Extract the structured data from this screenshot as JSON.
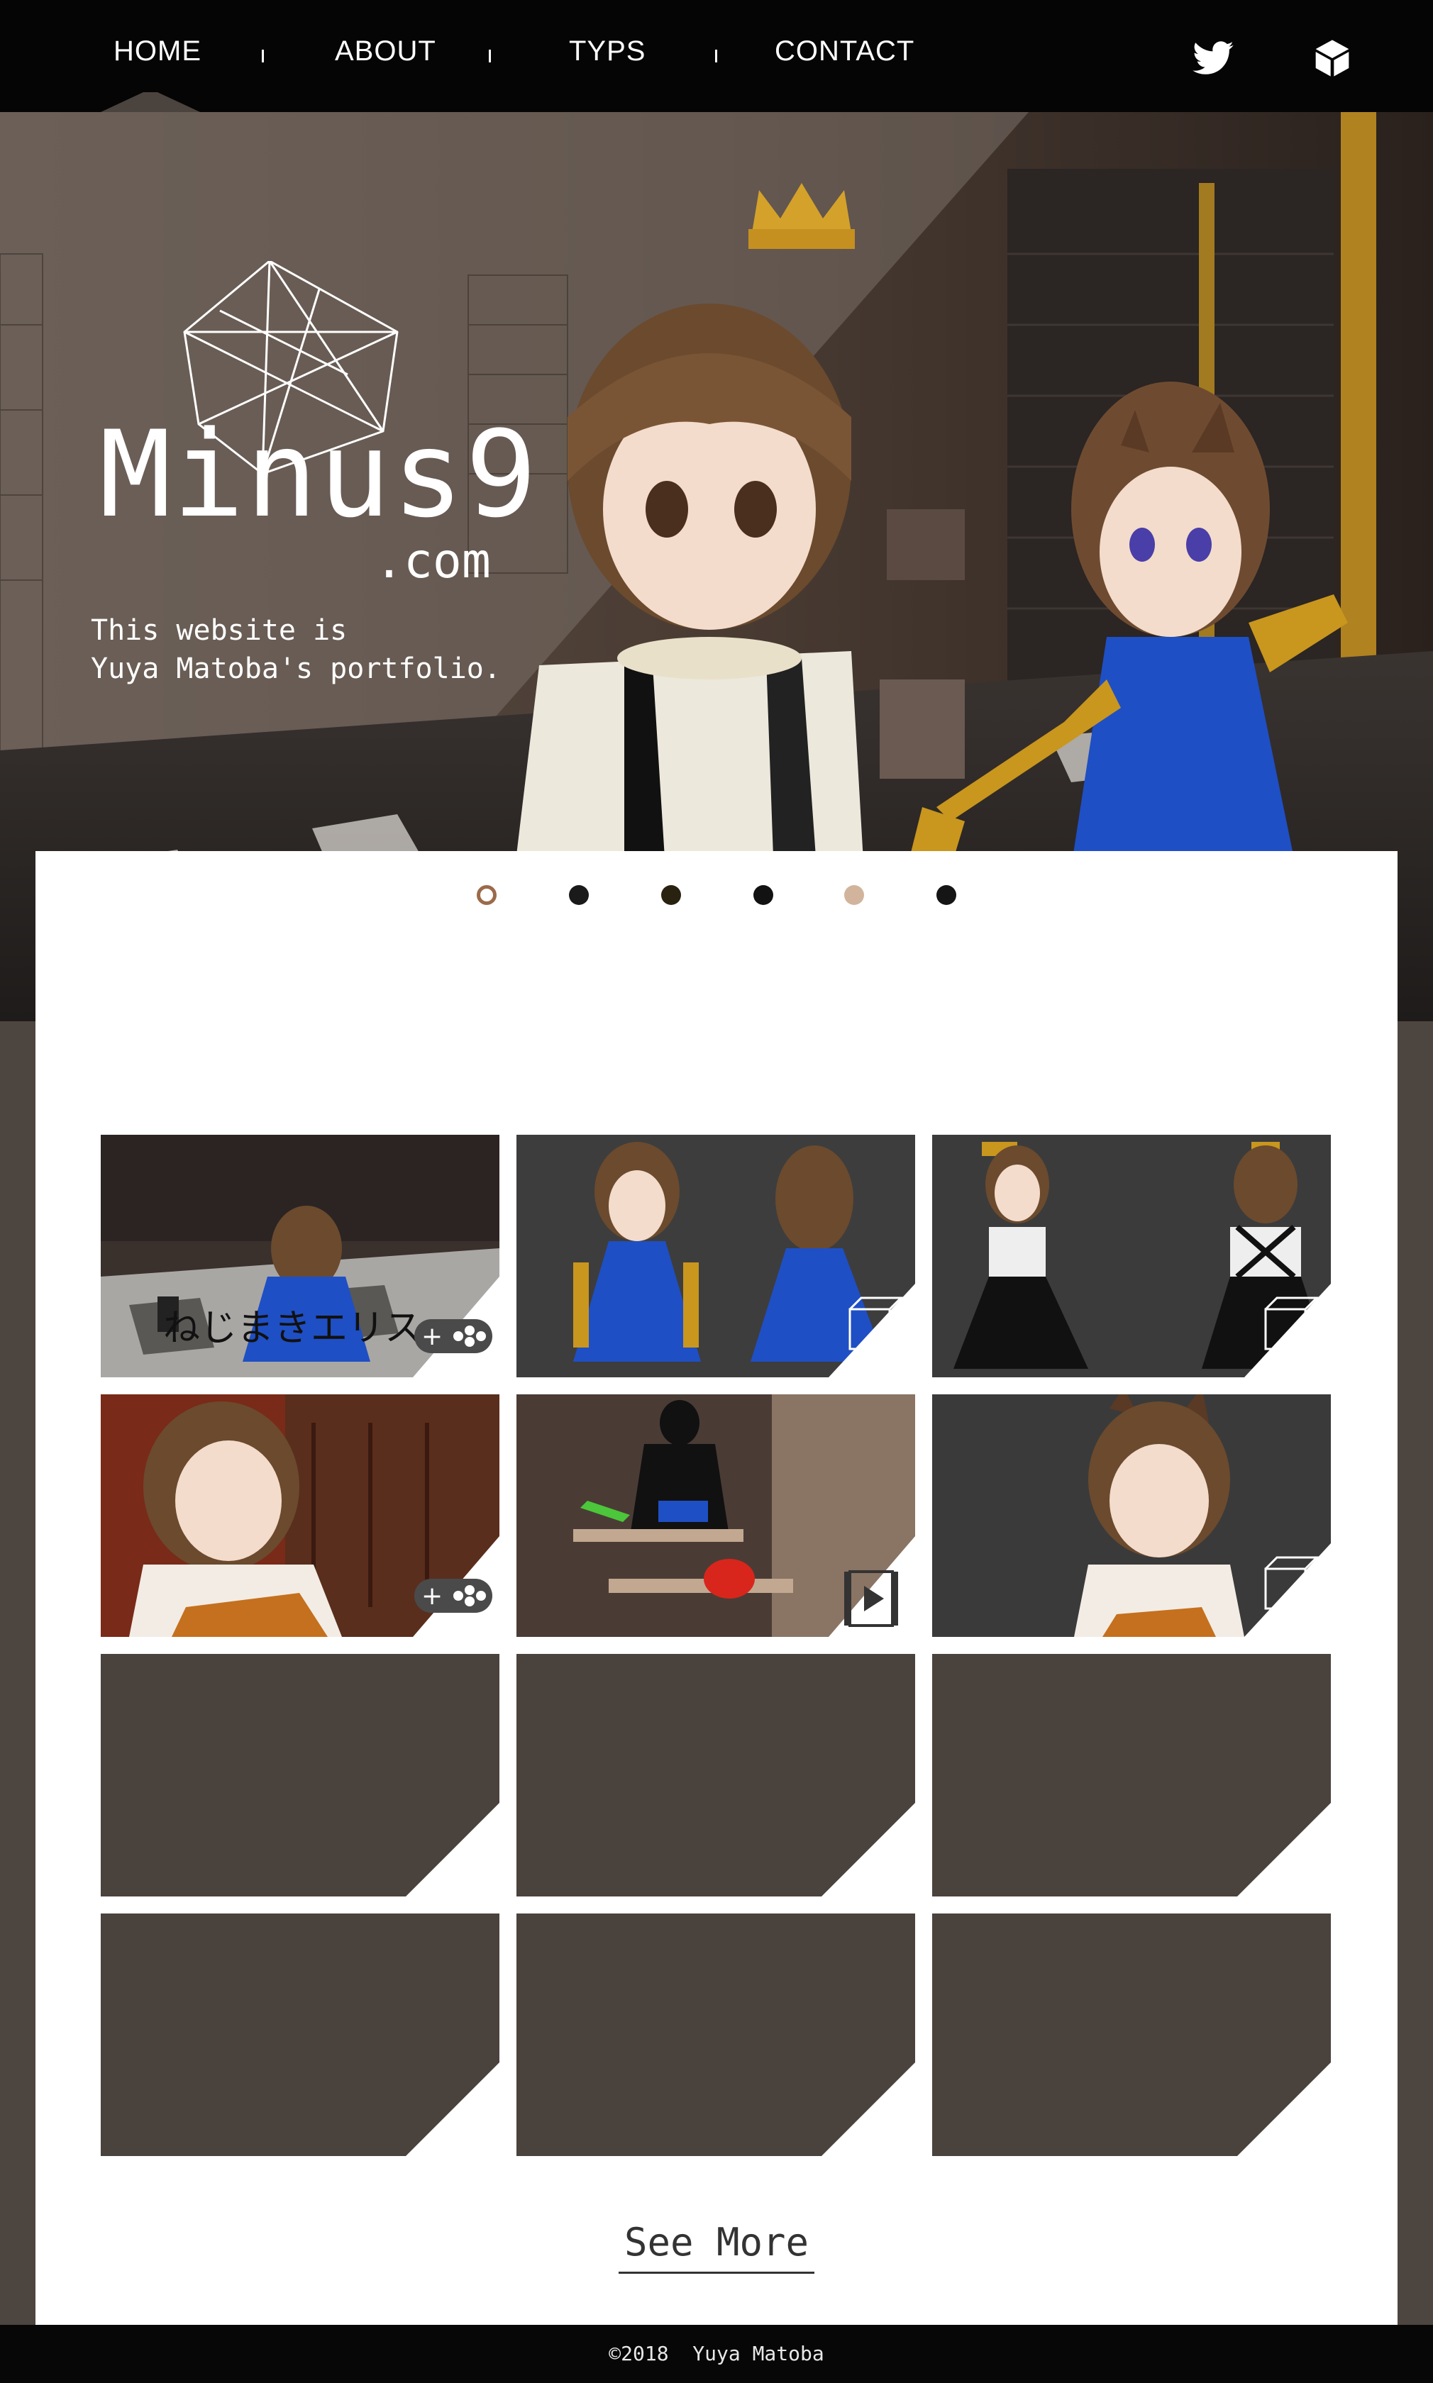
{
  "nav": {
    "items": [
      {
        "label": "HOME",
        "active": true
      },
      {
        "label": "ABOUT",
        "active": false
      },
      {
        "label": "TYPS",
        "active": false
      },
      {
        "label": "CONTACT",
        "active": false
      }
    ],
    "social": [
      {
        "icon": "twitter-bird-icon"
      },
      {
        "icon": "cube-icon"
      }
    ]
  },
  "hero": {
    "title": "Minus9",
    "domain": ".com",
    "description": "This website is\nYuya Matoba's portfolio.",
    "slide_count": 6,
    "active_slide": 1
  },
  "works": [
    {
      "type": "game",
      "icon": "gamepad-icon",
      "caption": "ねじまきエリス"
    },
    {
      "type": "model",
      "icon": "wireframe-cube-icon"
    },
    {
      "type": "model",
      "icon": "wireframe-cube-icon"
    },
    {
      "type": "game",
      "icon": "gamepad-icon"
    },
    {
      "type": "video",
      "icon": "film-strip-icon"
    },
    {
      "type": "model",
      "icon": "wireframe-cube-icon"
    },
    {
      "type": "empty"
    },
    {
      "type": "empty"
    },
    {
      "type": "empty"
    },
    {
      "type": "empty"
    },
    {
      "type": "empty"
    },
    {
      "type": "empty"
    }
  ],
  "see_more": "See More",
  "footer": "©2018  Yuya Matoba",
  "colors": {
    "nav_bg": "#050505",
    "page_bg": "#4d453f",
    "panel_bg": "#ffffff",
    "empty_tile": "#4a423c",
    "dress_blue": "#1f4fc4",
    "gold": "#c9961e"
  }
}
